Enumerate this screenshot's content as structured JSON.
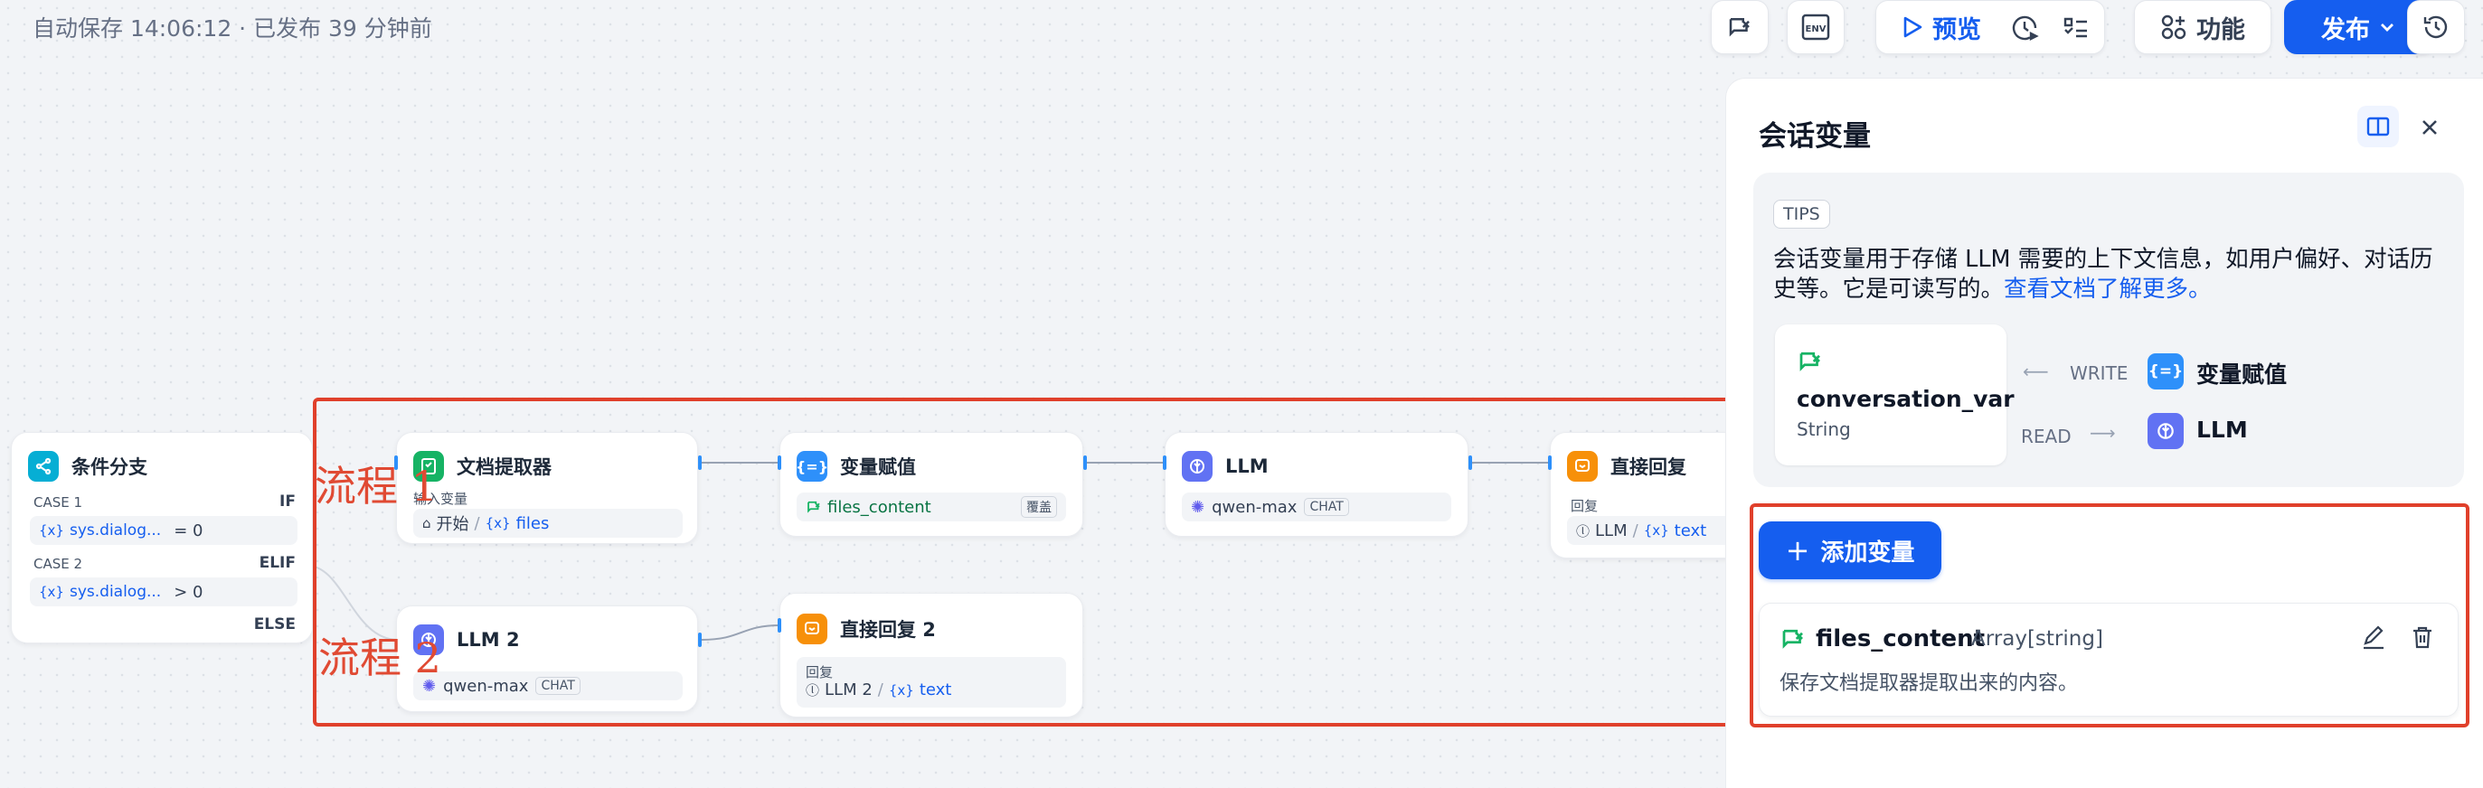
{
  "status": "自动保存 14:06:12 · 已发布 39 分钟前",
  "toolbar": {
    "env_label": "ENV",
    "preview_label": "预览",
    "features_label": "功能",
    "publish_label": "发布"
  },
  "nodes": {
    "condition": {
      "title": "条件分支",
      "case1_label": "CASE 1",
      "case1_kw": "IF",
      "case1_var": "sys.dialog...",
      "case1_cond": "= 0",
      "case2_label": "CASE 2",
      "case2_kw": "ELIF",
      "case2_var": "sys.dialog...",
      "case2_cond": "> 0",
      "else_kw": "ELSE"
    },
    "doc_extractor": {
      "title": "文档提取器",
      "input_label": "输入变量",
      "source": "开始",
      "var": "files"
    },
    "assigner": {
      "title": "变量赋值",
      "var": "files_content",
      "mode": "覆盖"
    },
    "llm1": {
      "title": "LLM",
      "model": "qwen-max",
      "mode": "CHAT"
    },
    "answer1": {
      "title": "直接回复",
      "reply_label": "回复",
      "source": "LLM",
      "var": "text"
    },
    "llm2": {
      "title": "LLM 2",
      "model": "qwen-max",
      "mode": "CHAT"
    },
    "answer2": {
      "title": "直接回复 2",
      "reply_label": "回复",
      "source": "LLM 2",
      "var": "text"
    }
  },
  "annotations": {
    "flow1": "流程 1",
    "flow2": "流程 2"
  },
  "panel": {
    "title": "会话变量",
    "tips_tag": "TIPS",
    "tips_text": "会话变量用于存储 LLM 需要的上下文信息，如用户偏好、对话历史等。它是可读写的。",
    "tips_link": "查看文档了解更多。",
    "example_var": {
      "name": "conversation_var",
      "type": "String"
    },
    "write_label": "WRITE",
    "write_target": "变量赋值",
    "read_label": "READ",
    "read_target": "LLM",
    "add_button": "添加变量",
    "variable": {
      "name": "files_content",
      "type": "Array[string]",
      "description": "保存文档提取器提取出来的内容。"
    }
  },
  "colors": {
    "primary": "#155eef",
    "annotation_red": "#e0402b",
    "condition_icon": "#06aed4",
    "extractor_icon": "#16b364",
    "assigner_icon": "#2e90fa",
    "llm_icon": "#6172f3",
    "answer_icon": "#f79009"
  }
}
